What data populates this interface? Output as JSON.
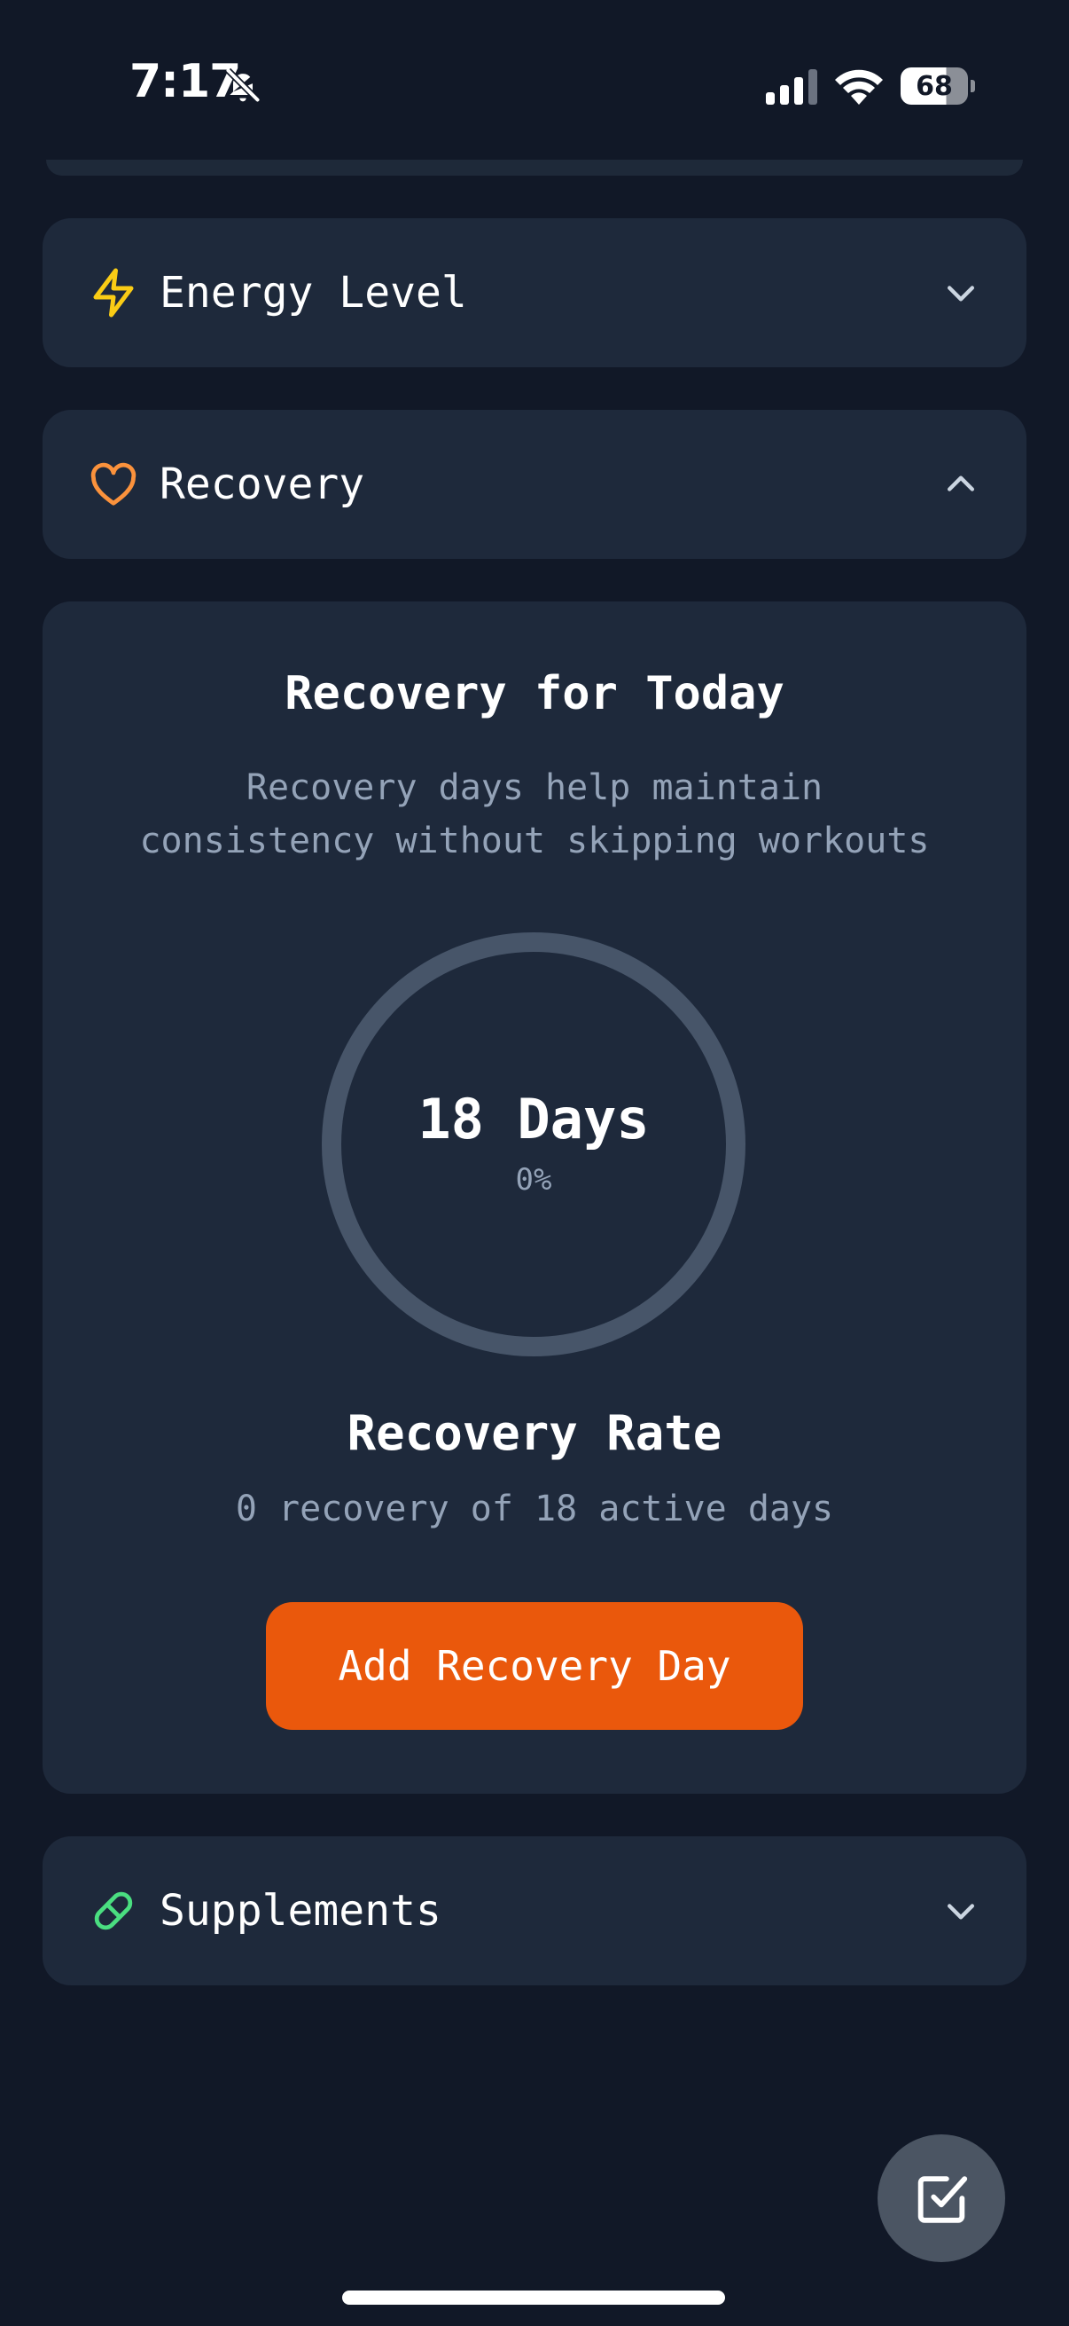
{
  "status_bar": {
    "time": "7:17",
    "battery": "68"
  },
  "sections": {
    "energy": {
      "title": "Energy Level",
      "icon": "lightning-icon",
      "icon_color": "#facc15",
      "expanded": false
    },
    "recovery": {
      "title": "Recovery",
      "icon": "heart-icon",
      "icon_color": "#fb923c",
      "expanded": true
    },
    "supplements": {
      "title": "Supplements",
      "icon": "pill-icon",
      "icon_color": "#4ade80",
      "expanded": false
    }
  },
  "recovery_panel": {
    "title": "Recovery for Today",
    "description_line1": "Recovery days help maintain",
    "description_line2": "consistency without skipping workouts",
    "ring_value": "18 Days",
    "ring_percent": "0%",
    "progress_fraction": 0,
    "rate_title": "Recovery Rate",
    "rate_subtitle": "0 recovery of 18 active days",
    "button_label": "Add Recovery Day"
  },
  "colors": {
    "background": "#111827",
    "card": "#1e293b",
    "accent": "#ea580c",
    "muted_text": "#94a3b8",
    "ring_track": "#475569"
  },
  "fab": {
    "icon": "checkbox-edit-icon"
  }
}
